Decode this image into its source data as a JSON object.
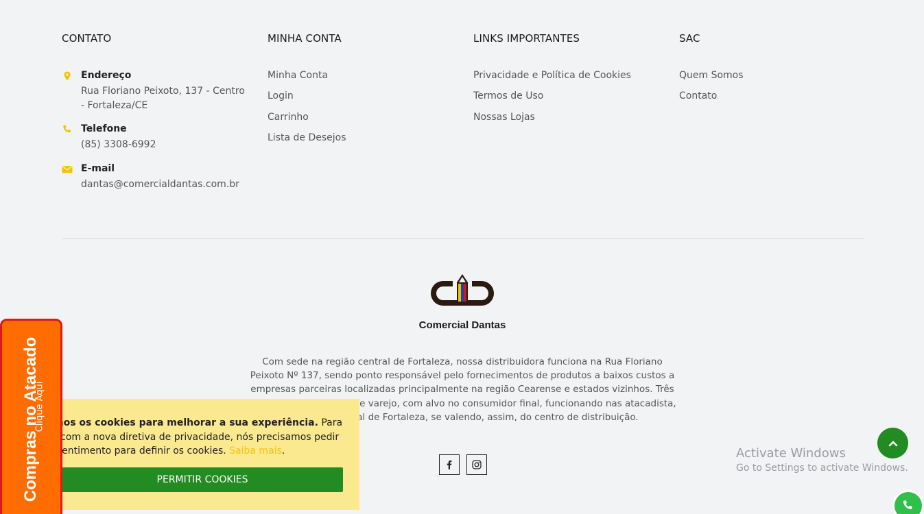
{
  "footer": {
    "contato": {
      "heading": "CONTATO",
      "address_title": "Endereço",
      "address_value": "Rua Floriano Peixoto, 137 - Centro - Fortaleza/CE",
      "phone_title": "Telefone",
      "phone_value": "(85) 3308-6992",
      "email_title": "E-mail",
      "email_value": "dantas@comercialdantas.com.br",
      "icon_color": "#f5c400"
    },
    "minha_conta": {
      "heading": "MINHA CONTA",
      "items": [
        "Minha Conta",
        "Login",
        "Carrinho",
        "Lista de Desejos"
      ]
    },
    "links_importantes": {
      "heading": "LINKS IMPORTANTES",
      "items": [
        "Privacidade e Política de Cookies",
        "Termos de Uso",
        "Nossas Lojas"
      ]
    },
    "sac": {
      "heading": "SAC",
      "items": [
        "Quem Somos",
        "Contato"
      ]
    },
    "brand": {
      "name": "Comercial Dantas"
    },
    "about": "Com sede na região central de Fortaleza, nossa distribuidora funciona na Rua Floriano Peixoto Nº 137, sendo ponto responsável pelo fornecimentos de produtos a baixos custos a empresas parceiras localizadas principalmente na região Cearense e estados vizinhos. Três das demais segmento de varejo, com alvo no consumidor final, funcionando nas atacadista, na região central de Fortaleza, se valendo, assim, do centro de distribuição.",
    "socials": [
      "facebook-icon",
      "instagram-icon"
    ]
  },
  "cookie_banner": {
    "line1_bold": "mos os cookies para melhorar a sua experiência.",
    "line1_rest": " Para",
    "line2": "ir com a nova diretiva de privacidade, nós precisamos pedir",
    "line3": "nsentimento para definir os cookies. ",
    "link": "Saiba mais",
    "line3_end": ".",
    "button": "PERMITIR COOKIES",
    "bg_color": "#fbe98f",
    "button_color": "#228b22"
  },
  "atacado_tab": {
    "title": "Compras no Atacado",
    "subtitle": "Clique Aqui",
    "bg_color": "#ff6d00",
    "border_color": "#e0171b"
  },
  "windows_watermark": {
    "line1": "Activate Windows",
    "line2": "Go to Settings to activate Windows."
  },
  "accent_green": "#228b22"
}
